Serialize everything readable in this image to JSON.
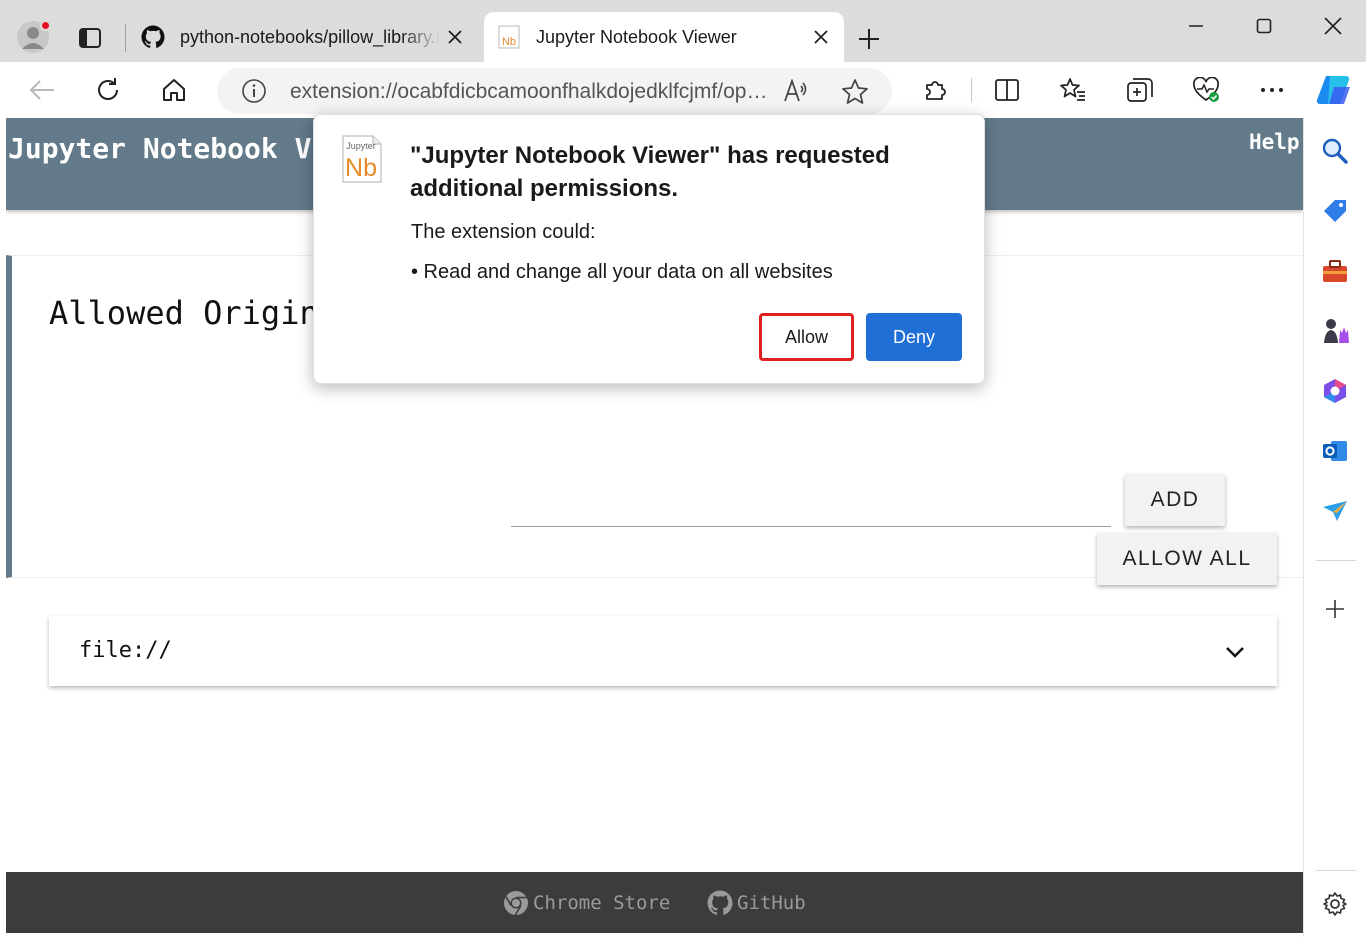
{
  "browser": {
    "tabs": [
      {
        "title": "python-notebooks/pillow_library.ipynb",
        "icon": "github-icon",
        "active": false
      },
      {
        "title": "Jupyter Notebook Viewer",
        "icon": "nb-favicon-icon",
        "active": true
      }
    ],
    "address": "extension://ocabfdicbcamoonfhalkdojedklfcjmf/options.html"
  },
  "page": {
    "header_title": "Jupyter Notebook Viewer",
    "help": "Help",
    "origins_title": "Allowed Origins",
    "add_label": "ADD",
    "allow_all_label": "ALLOW ALL",
    "origins": [
      {
        "value": "file://"
      }
    ],
    "footer": {
      "store": "Chrome Store",
      "github": "GitHub"
    },
    "colors": {
      "header": "#627a8a",
      "footer": "#3c3c3c"
    }
  },
  "dialog": {
    "icon_caption": "Jupyter",
    "icon_letters": "Nb",
    "title": "\"Jupyter Notebook Viewer\" has requested additional permissions.",
    "subtitle": "The extension could:",
    "permissions": [
      "• Read and change all your data on all websites"
    ],
    "allow_label": "Allow",
    "deny_label": "Deny",
    "colors": {
      "deny_bg": "#1f6fd6",
      "allow_highlight": "#e0201f"
    }
  }
}
